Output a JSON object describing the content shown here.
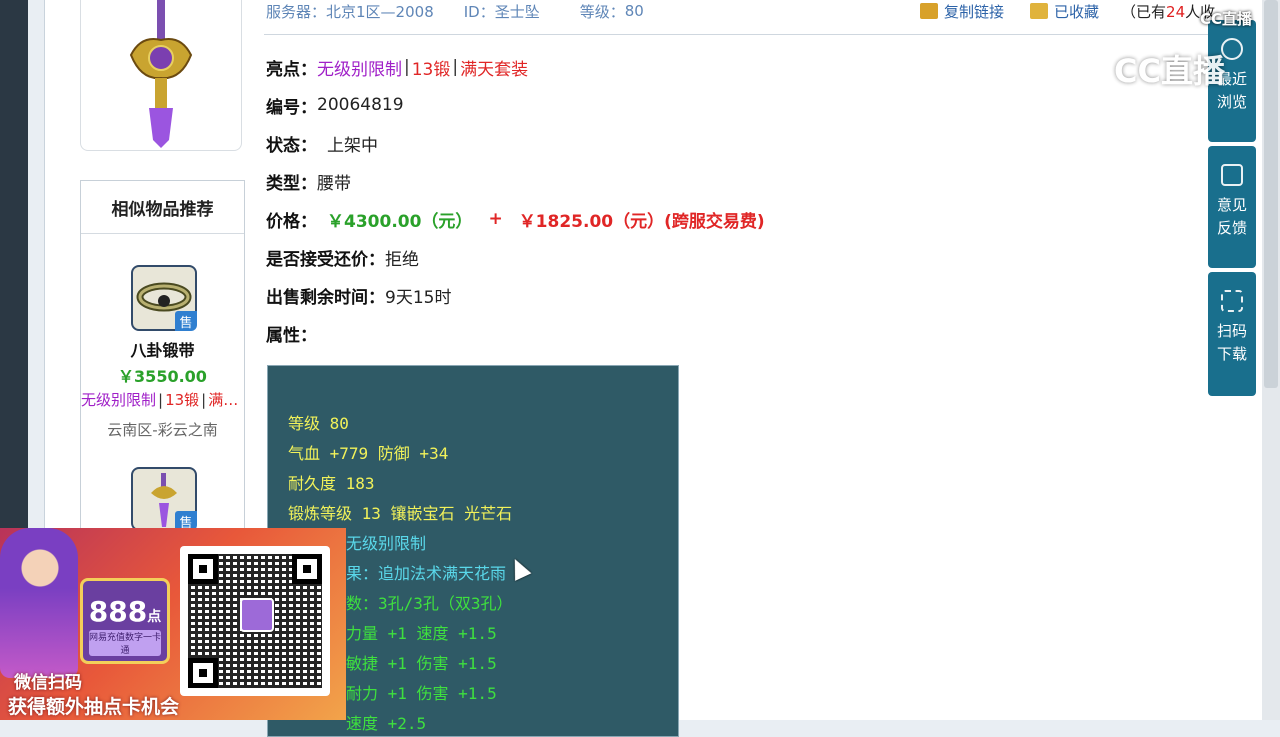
{
  "header": {
    "server_label": "服务器：",
    "server_value": "北京1区—2008",
    "id_label": "ID：",
    "id_value": "圣士坠",
    "level_label": "等级：",
    "level_value": "80",
    "copy_link": "复制链接",
    "favorited": "已收藏",
    "collect_prefix": "（已有",
    "collect_count": "24",
    "collect_suffix": "人收"
  },
  "fields": {
    "highlight_label": "亮点：",
    "highlight_tags": [
      "无级别限制",
      "13锻",
      "满天套装"
    ],
    "tag_sep": "|",
    "serial_label": "编号：",
    "serial_value": "20064819",
    "status_label": "状态：",
    "status_value": "上架中",
    "type_label": "类型：",
    "type_value": "腰带",
    "price_label": "价格：",
    "price_value": "￥4300.00（元）",
    "price_plus": "+",
    "price_fee": "￥1825.00（元）(跨服交易费)",
    "bargain_label": "是否接受还价：",
    "bargain_value": "拒绝",
    "remain_label": "出售剩余时间：",
    "remain_value": "9天15时",
    "attr_label": "属性："
  },
  "attributes": [
    {
      "text": "等级 80",
      "color": "yellow"
    },
    {
      "text": "气血 +779 防御 +34",
      "color": "yellow"
    },
    {
      "text": "耐久度 183",
      "color": "yellow"
    },
    {
      "text": "锻炼等级 13 镶嵌宝石 光芒石",
      "color": "yellow"
    },
    {
      "text": "无级别限制",
      "color": "cyan"
    },
    {
      "text": "果：追加法术满天花雨",
      "color": "cyan"
    },
    {
      "text": "数：3孔/3孔（双3孔）",
      "color": "green"
    },
    {
      "text": "力量 +1 速度 +1.5",
      "color": "green"
    },
    {
      "text": "敏捷 +1 伤害 +1.5",
      "color": "green"
    },
    {
      "text": "耐力 +1 伤害 +1.5",
      "color": "green"
    },
    {
      "text": "速度 +2.5",
      "color": "green"
    }
  ],
  "recommend": {
    "title": "相似物品推荐",
    "sale_tag": "售",
    "items": [
      {
        "name": "八卦锻带",
        "price": "￥3550.00",
        "tags": [
          "无级别限制",
          "13锻",
          "满…"
        ],
        "server": "云南区-彩云之南"
      }
    ]
  },
  "sidebar": {
    "recent": "最近\n浏览",
    "feedback": "意见\n反馈",
    "scan": "扫码\n下载"
  },
  "watermark": {
    "small": "CC直播",
    "big": "CC直播"
  },
  "promo": {
    "card_number": "888",
    "card_unit": "点",
    "card_sub": "网易充值数字一卡通",
    "line1": "微信扫码",
    "line2": "获得额外抽点卡机会"
  },
  "colors": {
    "price_green": "#2aa12a",
    "tag_purple": "#a020c8",
    "tag_red": "#e02626",
    "attr_bg": "#2f5a66",
    "sidebar_bg": "#196f8d"
  }
}
